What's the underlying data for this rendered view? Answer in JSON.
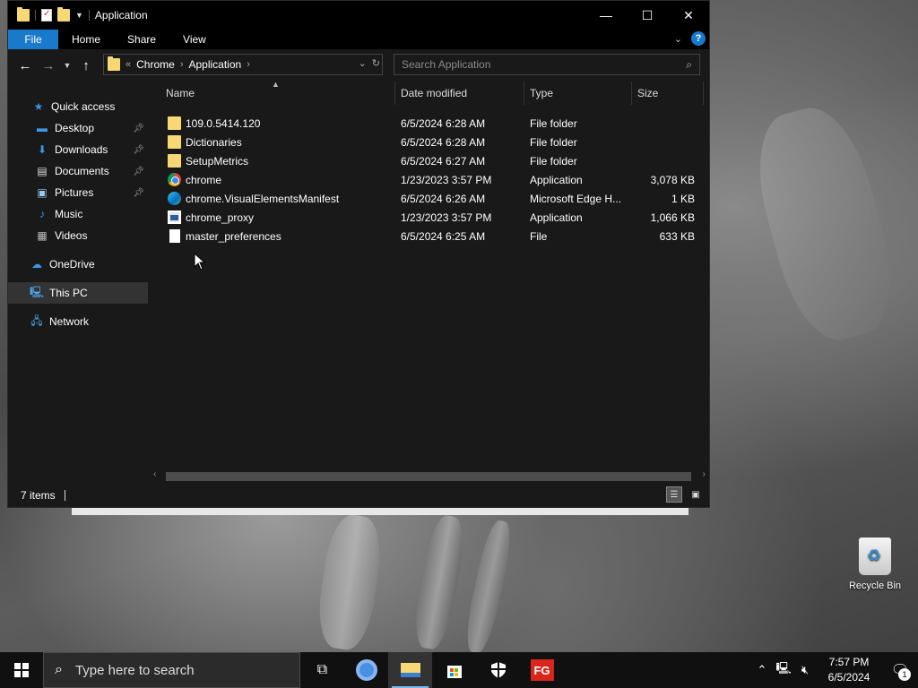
{
  "window": {
    "title": "Application",
    "controls": {
      "minimize": "—",
      "maximize": "☐",
      "close": "✕"
    }
  },
  "ribbon": {
    "tabs": [
      "File",
      "Home",
      "Share",
      "View"
    ],
    "help": "?"
  },
  "address": {
    "overflow": "«",
    "crumbs": [
      "Chrome",
      "Application"
    ]
  },
  "search": {
    "placeholder": "Search Application"
  },
  "sidebar": {
    "items": [
      {
        "label": "Quick access",
        "icon": "star-icon"
      },
      {
        "label": "Desktop",
        "icon": "desktop-icon",
        "pinned": true
      },
      {
        "label": "Downloads",
        "icon": "download-icon",
        "pinned": true
      },
      {
        "label": "Documents",
        "icon": "documents-icon",
        "pinned": true
      },
      {
        "label": "Pictures",
        "icon": "pictures-icon",
        "pinned": true
      },
      {
        "label": "Music",
        "icon": "music-icon"
      },
      {
        "label": "Videos",
        "icon": "videos-icon"
      },
      {
        "label": "OneDrive",
        "icon": "cloud-icon"
      },
      {
        "label": "This PC",
        "icon": "computer-icon",
        "selected": true
      },
      {
        "label": "Network",
        "icon": "network-icon"
      }
    ]
  },
  "columns": {
    "name": "Name",
    "date": "Date modified",
    "type": "Type",
    "size": "Size"
  },
  "files": [
    {
      "name": "109.0.5414.120",
      "date": "6/5/2024 6:28 AM",
      "type": "File folder",
      "size": "",
      "icon": "folder"
    },
    {
      "name": "Dictionaries",
      "date": "6/5/2024 6:28 AM",
      "type": "File folder",
      "size": "",
      "icon": "folder"
    },
    {
      "name": "SetupMetrics",
      "date": "6/5/2024 6:27 AM",
      "type": "File folder",
      "size": "",
      "icon": "folder"
    },
    {
      "name": "chrome",
      "date": "1/23/2023 3:57 PM",
      "type": "Application",
      "size": "3,078 KB",
      "icon": "chrome"
    },
    {
      "name": "chrome.VisualElementsManifest",
      "date": "6/5/2024 6:26 AM",
      "type": "Microsoft Edge H...",
      "size": "1 KB",
      "icon": "edge"
    },
    {
      "name": "chrome_proxy",
      "date": "1/23/2023 3:57 PM",
      "type": "Application",
      "size": "1,066 KB",
      "icon": "app"
    },
    {
      "name": "master_preferences",
      "date": "6/5/2024 6:25 AM",
      "type": "File",
      "size": "633 KB",
      "icon": "file"
    }
  ],
  "status": {
    "count": "7 items"
  },
  "desktop": {
    "recycle_bin": "Recycle Bin"
  },
  "taskbar": {
    "search_placeholder": "Type here to search",
    "time": "7:57 PM",
    "date": "6/5/2024",
    "notifications": "1",
    "apps": [
      "task-view-icon",
      "chrome-icon",
      "file-explorer-icon",
      "store-icon",
      "security-icon",
      "fg-app-icon"
    ]
  },
  "colors": {
    "accent": "#1979ca",
    "window_bg": "#191919",
    "titlebar_bg": "#000000",
    "folder": "#f8d775"
  }
}
